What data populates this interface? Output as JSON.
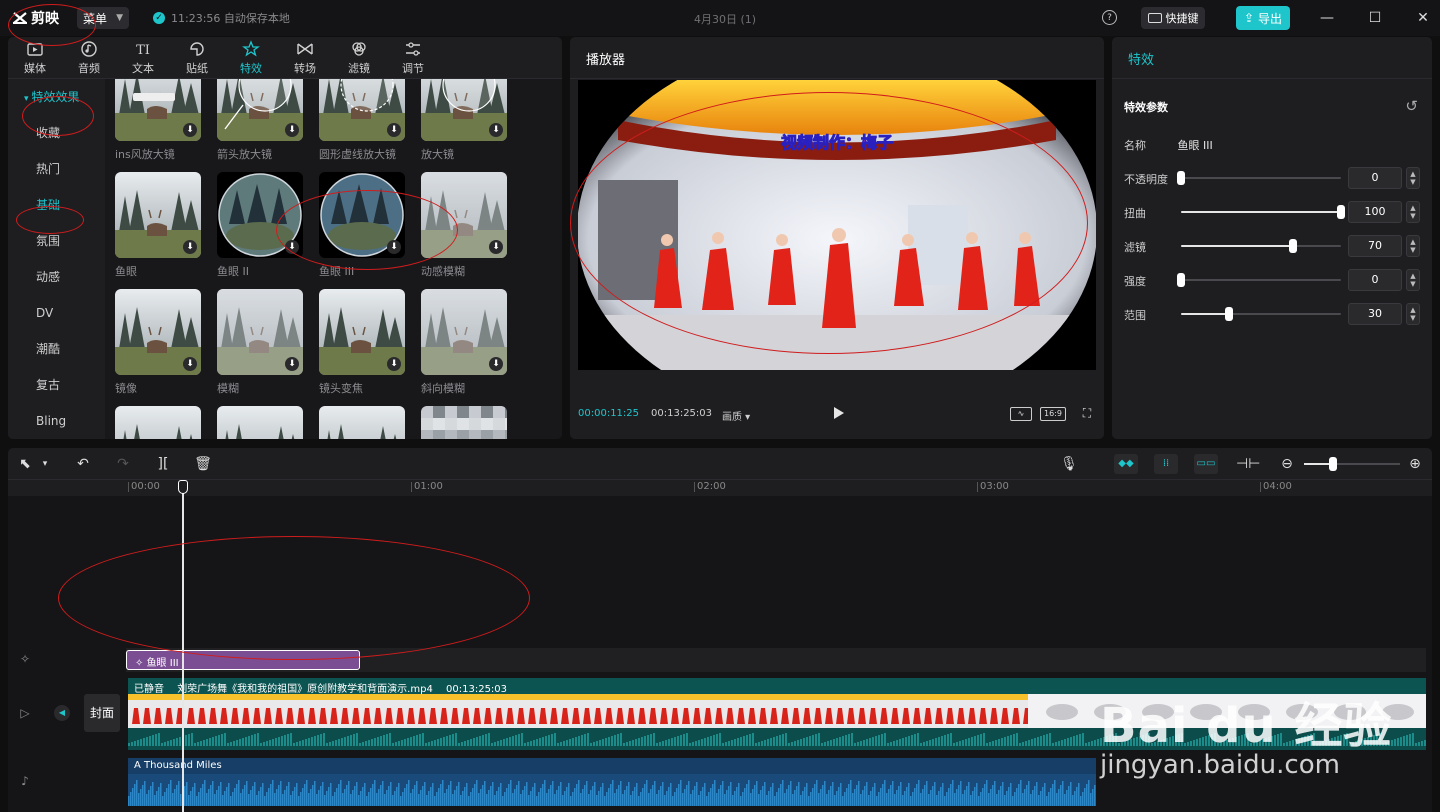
{
  "app": {
    "logo_text": "剪映",
    "menu_label": "菜单",
    "autosave_text": "11:23:56 自动保存本地",
    "doc_title": "4月30日 (1)",
    "shortcut_label": "快捷键",
    "export_label": "导出"
  },
  "tabs": [
    {
      "label": "媒体",
      "icon": "media-icon"
    },
    {
      "label": "音频",
      "icon": "audio-icon"
    },
    {
      "label": "文本",
      "icon": "text-icon"
    },
    {
      "label": "贴纸",
      "icon": "sticker-icon"
    },
    {
      "label": "特效",
      "icon": "effects-icon",
      "active": true
    },
    {
      "label": "转场",
      "icon": "transition-icon"
    },
    {
      "label": "滤镜",
      "icon": "filter-icon"
    },
    {
      "label": "调节",
      "icon": "adjust-icon"
    }
  ],
  "categories": [
    "特效效果",
    "收藏",
    "热门",
    "基础",
    "氛围",
    "动感",
    "DV",
    "潮酷",
    "复古",
    "Bling"
  ],
  "effects": [
    {
      "label": "ins风放大镜",
      "style": "ins"
    },
    {
      "label": "箭头放大镜",
      "style": "arrow"
    },
    {
      "label": "圆形虚线放大镜",
      "style": "dashed"
    },
    {
      "label": "放大镜",
      "style": "mag"
    },
    {
      "label": "鱼眼",
      "style": "plain"
    },
    {
      "label": "鱼眼 II",
      "style": "fisheye"
    },
    {
      "label": "鱼眼 III",
      "style": "fisheye3"
    },
    {
      "label": "动感模糊",
      "style": "blur"
    },
    {
      "label": "镜像",
      "style": "plain"
    },
    {
      "label": "模糊",
      "style": "blurred"
    },
    {
      "label": "镜头变焦",
      "style": "plain"
    },
    {
      "label": "斜向模糊",
      "style": "blur"
    },
    {
      "label": "",
      "style": "plain"
    },
    {
      "label": "",
      "style": "plain"
    },
    {
      "label": "",
      "style": "plain"
    },
    {
      "label": "",
      "style": "mosaic"
    }
  ],
  "player": {
    "title": "播放器",
    "current_time": "00:00:11:25",
    "total_time": "00:13:25:03",
    "quality_label": "画质",
    "ratio_label": "16:9",
    "video_caption": "视频制作：梅子"
  },
  "params": {
    "panel_title": "特效",
    "section_title": "特效参数",
    "name_label": "名称",
    "name_value": "鱼眼 III",
    "sliders": [
      {
        "label": "不透明度",
        "value": "0",
        "fraction": 0.0
      },
      {
        "label": "扭曲",
        "value": "100",
        "fraction": 1.0
      },
      {
        "label": "滤镜",
        "value": "70",
        "fraction": 0.7
      },
      {
        "label": "强度",
        "value": "0",
        "fraction": 0.0
      },
      {
        "label": "范围",
        "value": "30",
        "fraction": 0.3
      }
    ]
  },
  "timeline": {
    "ruler_labels": [
      "00:00",
      "01:00",
      "02:00",
      "03:00",
      "04:00"
    ],
    "fx_clip_label": "鱼眼 III",
    "video_clip": {
      "muted_label": "已静音",
      "file_name": "刘荣广场舞《我和我的祖国》原创附教学和背面演示.mp4",
      "duration": "00:13:25:03"
    },
    "cover_label": "封面",
    "audio_clip_label": "A Thousand Miles",
    "zoom_fraction": 0.3
  },
  "watermark": {
    "main": "Bai du 经验",
    "sub": "jingyan.baidu.com"
  },
  "colors": {
    "accent": "#1ec6cc",
    "fx_clip": "#7b4e93",
    "video_clip": "#0e5e5c",
    "audio_clip": "#1a4a7a",
    "annotation": "#d01c1c"
  }
}
